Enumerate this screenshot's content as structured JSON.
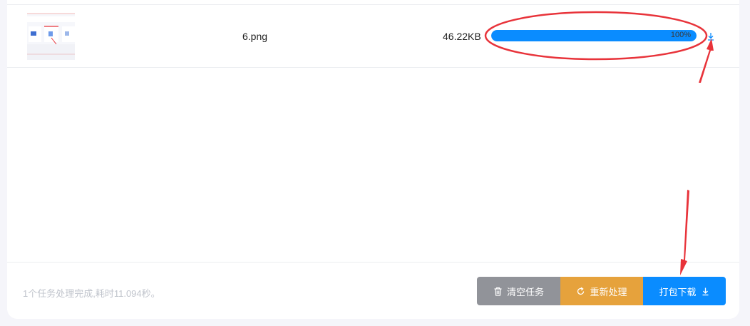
{
  "file_row": {
    "filename": "6.png",
    "filesize": "46.22KB",
    "progress_percent": 100,
    "progress_label": "100%"
  },
  "footer": {
    "status": "1个任务处理完成,耗时11.094秒。",
    "buttons": {
      "clear_label": "清空任务",
      "redo_label": "重新处理",
      "pack_label": "打包下载"
    }
  },
  "icons": {
    "row_download": "download-icon",
    "clear": "trash-icon",
    "redo": "refresh-icon",
    "pack": "download-icon"
  },
  "colors": {
    "progress": "#0a8cff",
    "clear_button": "#919399",
    "redo_button": "#e6a23c",
    "pack_button": "#0a8cff",
    "annotation": "#e8333a"
  }
}
